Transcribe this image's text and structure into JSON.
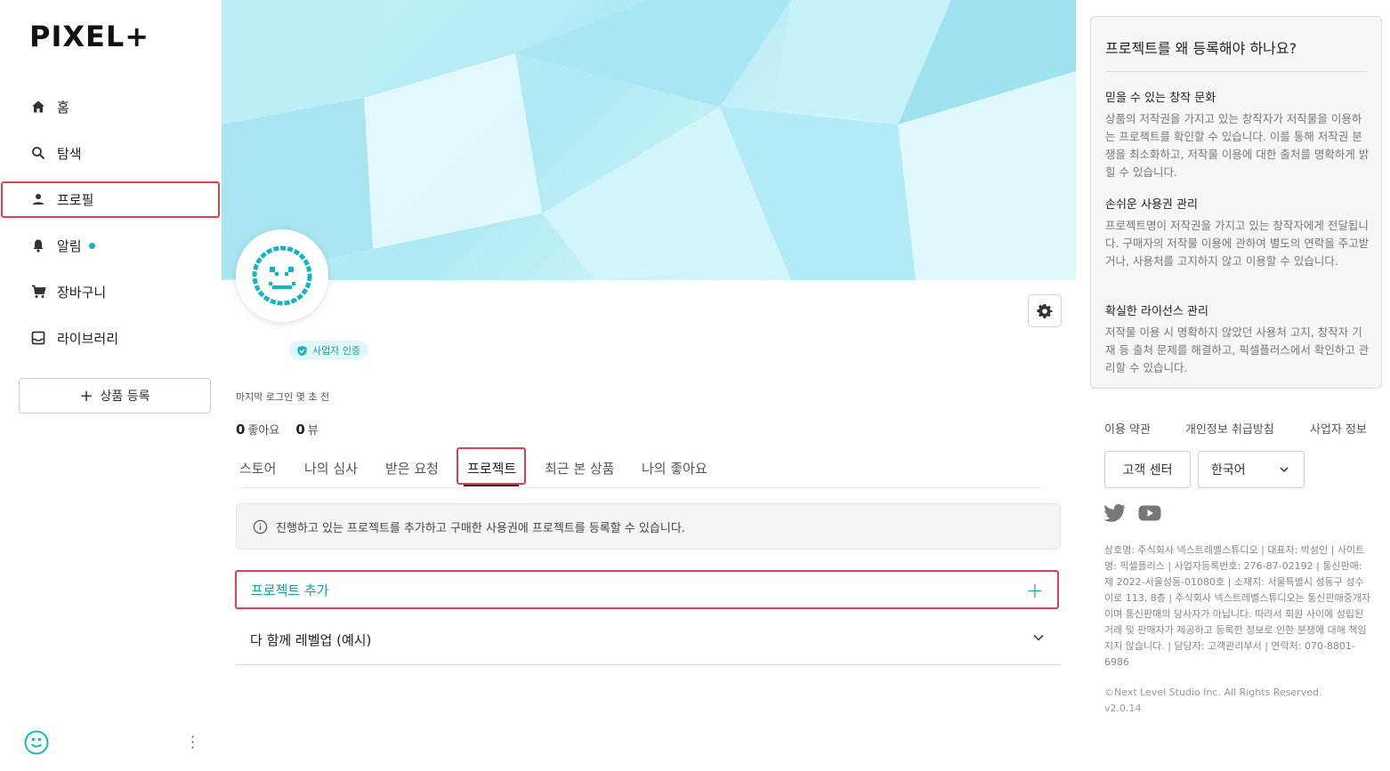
{
  "brand": {
    "logo_text": "PIXEL+"
  },
  "sidebar": {
    "items": [
      {
        "label": "홈",
        "icon": "home-icon"
      },
      {
        "label": "탐색",
        "icon": "search-icon"
      },
      {
        "label": "프로필",
        "icon": "person-icon"
      },
      {
        "label": "알림",
        "icon": "bell-icon"
      },
      {
        "label": "장바구니",
        "icon": "cart-icon"
      },
      {
        "label": "라이브러리",
        "icon": "library-icon"
      }
    ],
    "add_product_label": "상품 등록"
  },
  "profile": {
    "verify_badge": "사업자 인증",
    "last_login": "마지막 로그인 몇 초 전",
    "likes_count": "0",
    "likes_label": "좋아요",
    "views_count": "0",
    "views_label": "뷰"
  },
  "tabs": [
    {
      "label": "스토어"
    },
    {
      "label": "나의 심사"
    },
    {
      "label": "받은 요청"
    },
    {
      "label": "프로젝트",
      "active": true
    },
    {
      "label": "최근 본 상품"
    },
    {
      "label": "나의 좋아요"
    }
  ],
  "projects": {
    "notice": "진행하고 있는 프로젝트를 추가하고 구매한 사용권에 프로젝트를 등록할 수 있습니다.",
    "add_label": "프로젝트 추가",
    "items": [
      {
        "name": "다 함께 레벨업 (예시)"
      }
    ]
  },
  "why_card": {
    "title": "프로젝트를 왜 등록해야 하나요?",
    "sections": [
      {
        "heading": "믿을 수 있는 창작 문화",
        "body": "상품의 저작권을 가지고 있는 창작자가 저작물을 이용하는 프로젝트를 확인할 수 있습니다. 이를 통해 저작권 분쟁을 최소화하고, 저작물 이용에 대한 출처를 명확하게 밝힐 수 있습니다."
      },
      {
        "heading": "손쉬운 사용권 관리",
        "body": "프로젝트명이 저작권을 가지고 있는 창작자에게 전달됩니다. 구매자의 저작물 이용에 관하여 별도의 연락을 주고받거나, 사용처를 고지하지 않고 이용할 수 있습니다."
      },
      {
        "heading": "확실한 라이선스 관리",
        "body": "저작물 이용 시 명확하지 않았던 사용처 고지, 창작자 기재 등 출처 문제를 해결하고, 픽셀플러스에서 확인하고 관리할 수 있습니다."
      }
    ]
  },
  "footer": {
    "links": [
      "이용 약관",
      "개인정보 취급방침",
      "사업자 정보"
    ],
    "customer_center": "고객 센터",
    "language": "한국어",
    "business_info": "상호명: 주식회사 넥스트레벨스튜디오 | 대표자: 박성인 | 사이트명: 픽셀플러스 | 사업자등록번호: 276-87-02192 | 통신판매: 제 2022-서울성동-01080호 | 소재지: 서울특별시 성동구 성수이로 113, 8층 | 주식회사 넥스트레벨스튜디오는 통신판매중개자이며 통신판매의 당사자가 아닙니다. 따라서 회원 사이에 성립된 거래 및 판매자가 제공하고 등록한 정보로 인한 분쟁에 대해 책임지지 않습니다. | 담당자: 고객관리부서 | 연락처: 070-8801-6986",
    "copyright": "©Next Level Studio Inc. All Rights Reserved.",
    "version": "v2.0.14"
  },
  "colors": {
    "accent": "#16b5c1",
    "highlight": "#e0424d"
  }
}
